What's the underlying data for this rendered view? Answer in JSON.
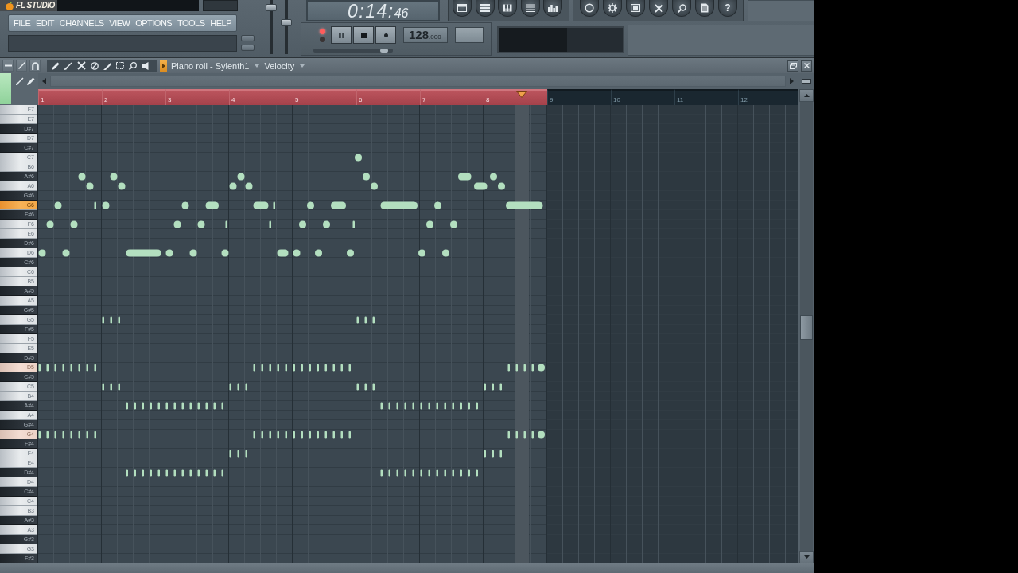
{
  "logo_text": "FL STUDIO",
  "menu": [
    "FILE",
    "EDIT",
    "CHANNELS",
    "VIEW",
    "OPTIONS",
    "TOOLS",
    "HELP"
  ],
  "sliders": [
    {
      "level": 0.91
    },
    {
      "level": 0.6
    }
  ],
  "transport": {
    "time": "0:14:",
    "time_small": "46",
    "leds": [
      {
        "on": true
      },
      {
        "on": false
      }
    ],
    "buttons": [
      {
        "kind": "pause"
      },
      {
        "kind": "stop"
      },
      {
        "kind": "record"
      }
    ],
    "tempo": "128",
    "tempo_small": ".000",
    "position_slider": {
      "level": 0.93
    }
  },
  "toolbar_groups": [
    [
      {
        "kind": "window"
      },
      {
        "kind": "bars"
      },
      {
        "kind": "keyboard"
      },
      {
        "kind": "list"
      },
      {
        "kind": "mixer"
      }
    ],
    [
      {
        "kind": "ring"
      },
      {
        "kind": "gear"
      },
      {
        "kind": "box"
      },
      {
        "kind": "cross"
      },
      {
        "kind": "magnifier"
      },
      {
        "kind": "page"
      },
      {
        "kind": "help",
        "glyph": "?"
      }
    ]
  ],
  "piano_roll": {
    "title": "Piano roll - Sylenth1",
    "target": "Velocity",
    "header_buttons": [
      {
        "kind": "minus"
      },
      {
        "kind": "slash"
      },
      {
        "kind": "magnet"
      }
    ],
    "tools": [
      {
        "kind": "pencil"
      },
      {
        "kind": "brush"
      },
      {
        "kind": "cross"
      },
      {
        "kind": "mute"
      },
      {
        "kind": "knife"
      },
      {
        "kind": "select"
      },
      {
        "kind": "zoom"
      },
      {
        "kind": "speaker"
      }
    ],
    "ruler": [
      {
        "label": "1",
        "selected": true
      },
      {
        "label": "2",
        "selected": true
      },
      {
        "label": "3",
        "selected": true
      },
      {
        "label": "4",
        "selected": true
      },
      {
        "label": "5",
        "selected": true
      },
      {
        "label": "6",
        "selected": true
      },
      {
        "label": "7",
        "selected": true
      },
      {
        "label": "8",
        "selected": true
      },
      {
        "label": "9",
        "selected": false
      },
      {
        "label": "10",
        "selected": false
      },
      {
        "label": "11",
        "selected": false
      },
      {
        "label": "12",
        "selected": false
      }
    ],
    "playhead": {
      "level": 0.636
    },
    "keys": [
      {
        "label": "F7",
        "kind": "white",
        "selected": false,
        "playing": false
      },
      {
        "label": "E7",
        "kind": "white",
        "selected": false,
        "playing": false
      },
      {
        "label": "D#7",
        "kind": "black",
        "selected": false,
        "playing": false
      },
      {
        "label": "D7",
        "kind": "white",
        "selected": false,
        "playing": false
      },
      {
        "label": "C#7",
        "kind": "black",
        "selected": false,
        "playing": false
      },
      {
        "label": "C7",
        "kind": "white",
        "selected": false,
        "playing": false
      },
      {
        "label": "B6",
        "kind": "white",
        "selected": false,
        "playing": false
      },
      {
        "label": "A#6",
        "kind": "black",
        "selected": false,
        "playing": false
      },
      {
        "label": "A6",
        "kind": "white",
        "selected": false,
        "playing": false
      },
      {
        "label": "G#6",
        "kind": "black",
        "selected": false,
        "playing": false
      },
      {
        "label": "G6",
        "kind": "white",
        "selected": true,
        "playing": false
      },
      {
        "label": "F#6",
        "kind": "black",
        "selected": false,
        "playing": false
      },
      {
        "label": "F6",
        "kind": "white",
        "selected": false,
        "playing": false
      },
      {
        "label": "E6",
        "kind": "white",
        "selected": false,
        "playing": false
      },
      {
        "label": "D#6",
        "kind": "black",
        "selected": false,
        "playing": false
      },
      {
        "label": "D6",
        "kind": "white",
        "selected": false,
        "playing": false
      },
      {
        "label": "C#6",
        "kind": "black",
        "selected": false,
        "playing": false
      },
      {
        "label": "C6",
        "kind": "white",
        "selected": false,
        "playing": false
      },
      {
        "label": "B5",
        "kind": "white",
        "selected": false,
        "playing": false
      },
      {
        "label": "A#5",
        "kind": "black",
        "selected": false,
        "playing": false
      },
      {
        "label": "A5",
        "kind": "white",
        "selected": false,
        "playing": false
      },
      {
        "label": "G#5",
        "kind": "black",
        "selected": false,
        "playing": false
      },
      {
        "label": "G5",
        "kind": "white",
        "selected": false,
        "playing": false
      },
      {
        "label": "F#5",
        "kind": "black",
        "selected": false,
        "playing": false
      },
      {
        "label": "F5",
        "kind": "white",
        "selected": false,
        "playing": false
      },
      {
        "label": "E5",
        "kind": "white",
        "selected": false,
        "playing": false
      },
      {
        "label": "D#5",
        "kind": "black",
        "selected": false,
        "playing": false
      },
      {
        "label": "D5",
        "kind": "white",
        "selected": false,
        "playing": true
      },
      {
        "label": "C#5",
        "kind": "black",
        "selected": false,
        "playing": false
      },
      {
        "label": "C5",
        "kind": "white",
        "selected": false,
        "playing": false
      },
      {
        "label": "B4",
        "kind": "white",
        "selected": false,
        "playing": false
      },
      {
        "label": "A#4",
        "kind": "black",
        "selected": false,
        "playing": false
      },
      {
        "label": "A4",
        "kind": "white",
        "selected": false,
        "playing": false
      },
      {
        "label": "G#4",
        "kind": "black",
        "selected": false,
        "playing": false
      },
      {
        "label": "G4",
        "kind": "white",
        "selected": false,
        "playing": true
      },
      {
        "label": "F#4",
        "kind": "black",
        "selected": false,
        "playing": false
      },
      {
        "label": "F4",
        "kind": "white",
        "selected": false,
        "playing": false
      },
      {
        "label": "E4",
        "kind": "white",
        "selected": false,
        "playing": false
      },
      {
        "label": "D#4",
        "kind": "black",
        "selected": false,
        "playing": false
      },
      {
        "label": "D4",
        "kind": "white",
        "selected": false,
        "playing": false
      },
      {
        "label": "C#4",
        "kind": "black",
        "selected": false,
        "playing": false
      },
      {
        "label": "C4",
        "kind": "white",
        "selected": false,
        "playing": false
      },
      {
        "label": "B3",
        "kind": "white",
        "selected": false,
        "playing": false
      },
      {
        "label": "A#3",
        "kind": "black",
        "selected": false,
        "playing": false
      },
      {
        "label": "A3",
        "kind": "white",
        "selected": false,
        "playing": false
      },
      {
        "label": "G#3",
        "kind": "black",
        "selected": false,
        "playing": false
      },
      {
        "label": "G3",
        "kind": "white",
        "selected": false,
        "playing": false
      },
      {
        "label": "F#3",
        "kind": "black",
        "selected": false,
        "playing": false
      }
    ]
  }
}
